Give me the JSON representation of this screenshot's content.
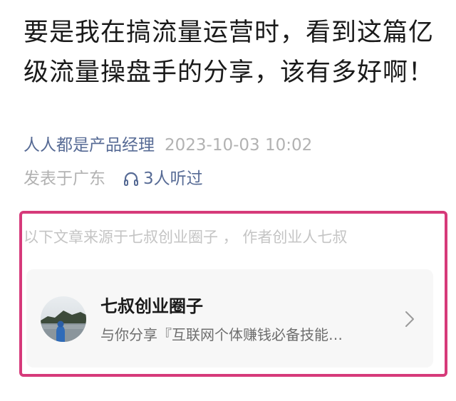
{
  "article": {
    "title": "要是我在搞流量运营时，看到这篇亿级流量操盘手的分享，该有多好啊！",
    "author": "人人都是产品经理",
    "timestamp": "2023-10-03 10:02",
    "location": "发表于广东",
    "listen_count": "3人听过"
  },
  "source": {
    "note": "以下文章来源于七叔创业圈子 ， 作者创业人七叔"
  },
  "account_card": {
    "name": "七叔创业圈子",
    "description": "与你分享『互联网个体赚钱必备技能…",
    "avatar_icon": "avatar-landscape-photo",
    "chevron_icon": "chevron-right-icon"
  },
  "colors": {
    "link": "#576b95",
    "muted": "#b2b2b2",
    "highlight_border": "#d63a7a",
    "card_bg": "#f7f7f7"
  }
}
